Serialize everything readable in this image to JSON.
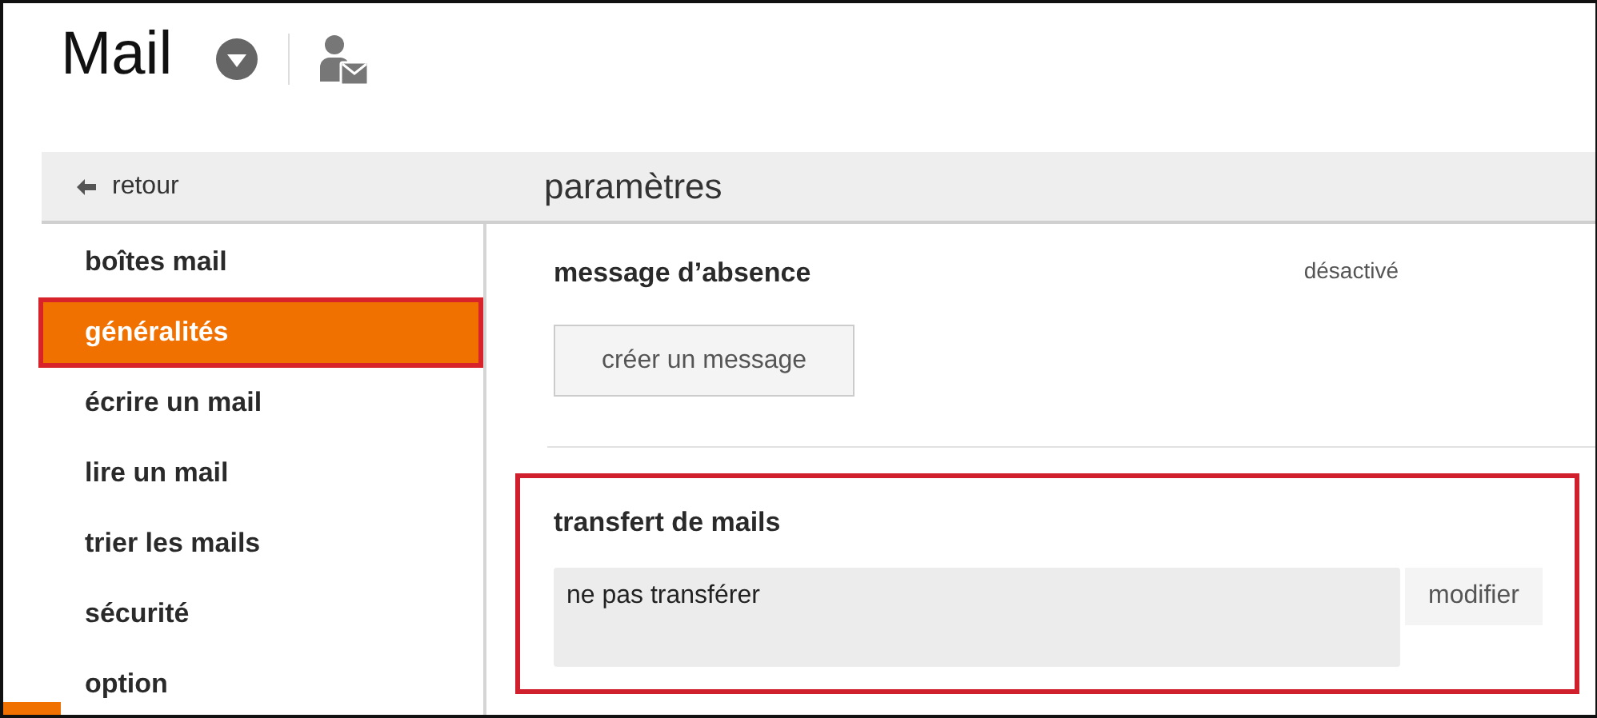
{
  "header": {
    "title": "Mail"
  },
  "back": {
    "label": "retour"
  },
  "sidebar": {
    "items": [
      {
        "label": "boîtes mail",
        "selected": false,
        "highlighted": false
      },
      {
        "label": "généralités",
        "selected": true,
        "highlighted": true
      },
      {
        "label": "écrire un mail",
        "selected": false,
        "highlighted": false
      },
      {
        "label": "lire un mail",
        "selected": false,
        "highlighted": false
      },
      {
        "label": "trier les mails",
        "selected": false,
        "highlighted": false
      },
      {
        "label": "sécurité",
        "selected": false,
        "highlighted": false
      },
      {
        "label": "option",
        "selected": false,
        "highlighted": false
      }
    ]
  },
  "main": {
    "title": "paramètres",
    "absence": {
      "heading": "message d’absence",
      "status": "désactivé",
      "button": "créer un message",
      "highlighted": false
    },
    "forwarding": {
      "heading": "transfert de mails",
      "value": "ne pas transférer",
      "button": "modifier",
      "highlighted": true
    }
  }
}
